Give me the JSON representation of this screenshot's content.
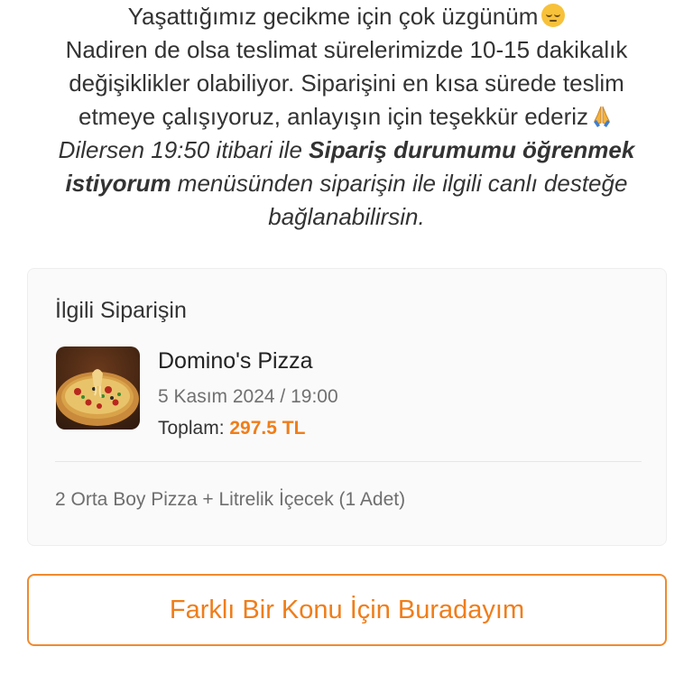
{
  "message": {
    "line1": "Yaşattığımız gecikme için çok üzgünüm",
    "line2": "Nadiren de olsa teslimat sürelerimizde 10-15 dakikalık",
    "line3": "değişiklikler olabiliyor. Siparişini en kısa sürede teslim",
    "line4": "etmeye çalışıyoruz, anlayışın için teşekkür ederiz",
    "line5_prefix": "Dilersen 19:50 itibari ile ",
    "line5_bold": "Sipariş durumumu öğrenmek",
    "line6_bold": "istiyorum",
    "line6_suffix": " menüsünden siparişin ile ilgili canlı desteğe",
    "line7": "bağlanabilirsin.",
    "icons": [
      "pensive-face-emoji",
      "folded-hands-emoji"
    ]
  },
  "order": {
    "section_title": "İlgili Siparişin",
    "restaurant": "Domino's Pizza",
    "datetime": "5 Kasım 2024 / 19:00",
    "total_label": "Toplam: ",
    "total_value": "297.5 TL",
    "items": "2 Orta Boy Pizza + Litrelik İçecek (1 Adet)",
    "image": "pizza-thumbnail"
  },
  "cta": {
    "label": "Farklı Bir Konu İçin Buradayım"
  },
  "colors": {
    "accent": "#f07d1a",
    "card_bg": "#fafafa",
    "text": "#333333"
  }
}
